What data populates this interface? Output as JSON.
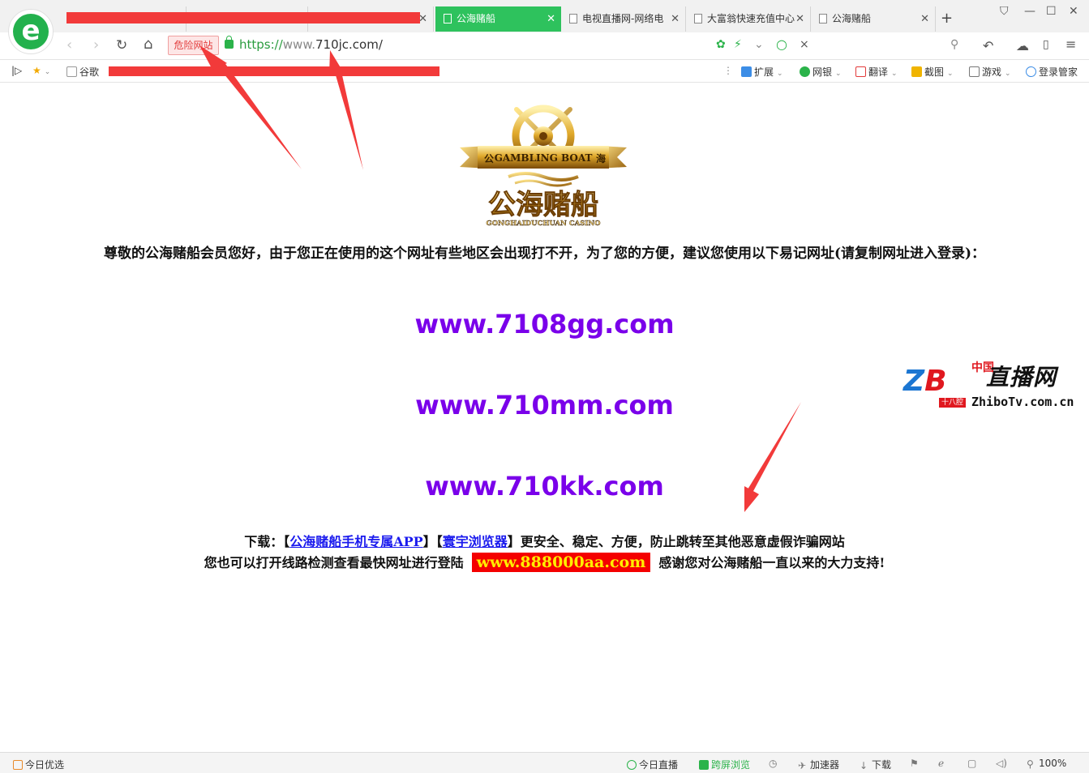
{
  "tabs": [
    {
      "label": "",
      "active": false
    },
    {
      "label": "",
      "active": false
    },
    {
      "label": "公海赌船",
      "active": true
    },
    {
      "label": "电视直播网-网络电",
      "active": false
    },
    {
      "label": "大富翁快速充值中心",
      "active": false
    },
    {
      "label": "公海赌船",
      "active": false
    }
  ],
  "toolbar": {
    "danger_label": "危险网站",
    "url_scheme": "https://",
    "url_host_prefix": "www.",
    "url_host": "710jc.com/"
  },
  "bookmarks": {
    "first": "谷歌",
    "right": [
      {
        "label": "扩展"
      },
      {
        "label": "网银"
      },
      {
        "label": "翻译"
      },
      {
        "label": "截图"
      },
      {
        "label": "游戏"
      },
      {
        "label": "登录管家"
      }
    ]
  },
  "page": {
    "logo_ribbon": "GAMBLING BOAT",
    "logo_left_char": "公",
    "logo_right_char": "海",
    "logo_cn": "公海赌船",
    "logo_en": "GONGHAIDUCHUAN CASINO",
    "notice": "尊敬的公海赌船会员您好，由于您正在使用的这个网址有些地区会出现打不开，为了您的方便，建议您使用以下易记网址(请复制网址进入登录)：",
    "links": [
      "www.7108gg.com",
      "www.710mm.com",
      "www.710kk.com"
    ],
    "download_prefix": "下载：【",
    "download_app": "公海赌船手机专属APP",
    "download_mid": "】【",
    "download_browser": "寰宇浏览器",
    "download_suffix": "】更安全、稳定、方便，防止跳转至其他恶意虚假诈骗网站",
    "check_prefix": "您也可以打开线路检测查看最快网址进行登陆",
    "check_url": "www.888000aa.com",
    "check_suffix": "感谢您对公海赌船一直以来的大力支持!"
  },
  "watermark": {
    "zb": "ZB",
    "cn": "中国",
    "title": "直播网",
    "tag": "十八腔",
    "site": "ZhiboTv.com.cn"
  },
  "statusbar": {
    "left": "今日优选",
    "items": [
      "今日直播",
      "跨屏浏览",
      "加速器",
      "下载"
    ],
    "zoom": "100%"
  },
  "colors": {
    "active_tab": "#2ec25d",
    "link_purple": "#7a00ea",
    "highlight_red": "#f40000",
    "highlight_yellow": "#ffee00",
    "annotation_red": "#f23a3a"
  }
}
